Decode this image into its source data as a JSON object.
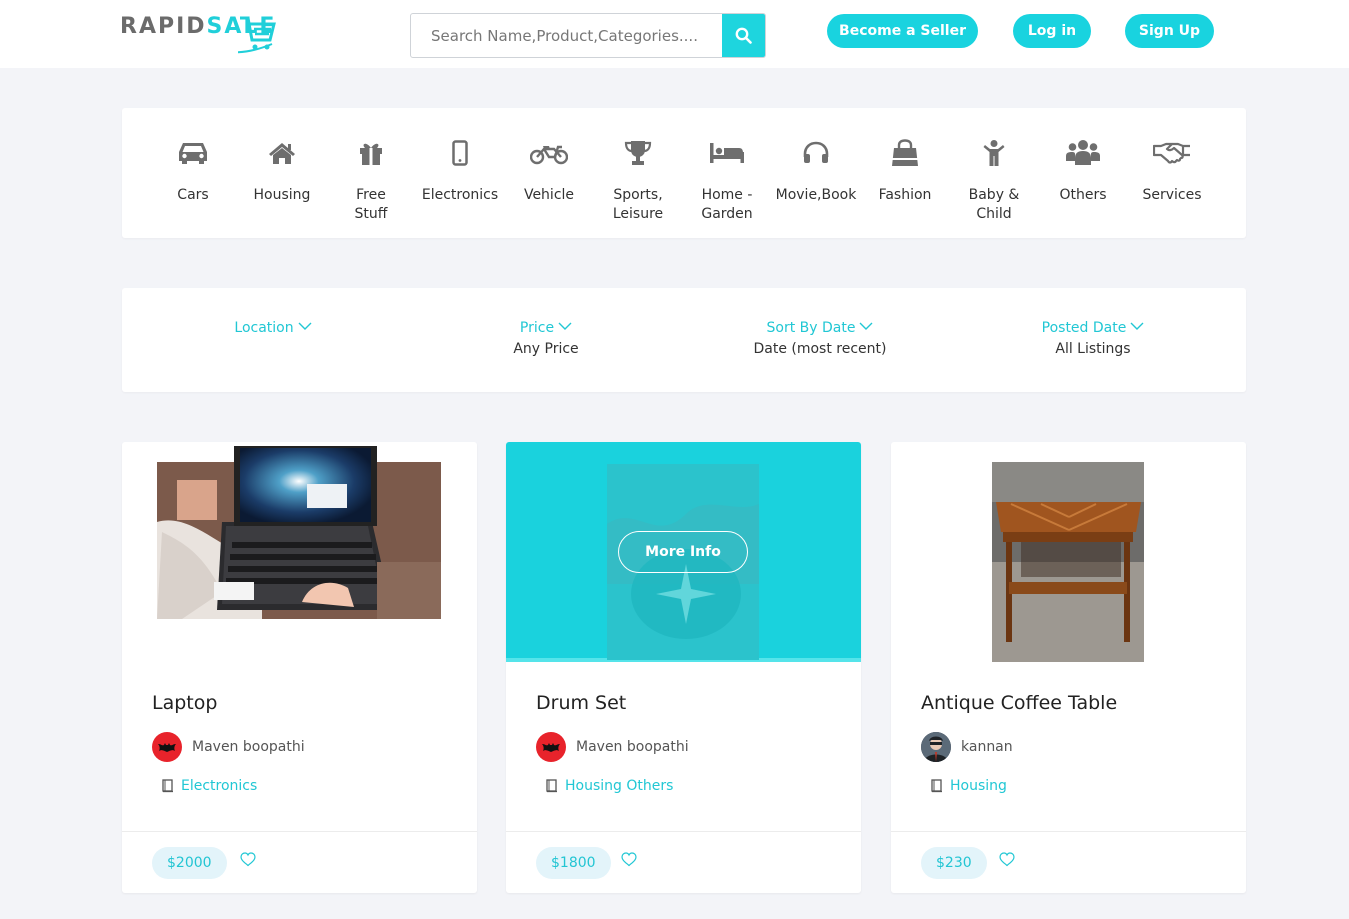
{
  "brand": {
    "part1": "RAPID",
    "part2": "SALE"
  },
  "search": {
    "placeholder": "Search Name,Product,Categories...."
  },
  "header_buttons": {
    "seller": "Become a Seller",
    "login": "Log in",
    "signup": "Sign Up"
  },
  "categories": [
    {
      "label": "Cars",
      "icon": "car-icon"
    },
    {
      "label": "Housing",
      "icon": "home-icon"
    },
    {
      "label": "Free Stuff",
      "icon": "gift-icon"
    },
    {
      "label": "Electronics",
      "icon": "mobile-icon"
    },
    {
      "label": "Vehicle",
      "icon": "motorcycle-icon"
    },
    {
      "label": "Sports, Leisure",
      "icon": "trophy-icon"
    },
    {
      "label": "Home - Garden",
      "icon": "bed-icon"
    },
    {
      "label": "Movie,Book",
      "icon": "headphones-icon"
    },
    {
      "label": "Fashion",
      "icon": "shopping-bag-icon"
    },
    {
      "label": "Baby & Child",
      "icon": "child-icon"
    },
    {
      "label": "Others",
      "icon": "users-icon"
    },
    {
      "label": "Services",
      "icon": "handshake-icon"
    }
  ],
  "filters": [
    {
      "title": "Location",
      "value": ""
    },
    {
      "title": "Price",
      "value": "Any Price"
    },
    {
      "title": "Sort By Date",
      "value": "Date (most recent)"
    },
    {
      "title": "Posted Date",
      "value": "All Listings"
    }
  ],
  "listings": [
    {
      "title": "Laptop",
      "seller": "Maven boopathi",
      "category": "Electronics",
      "price": "$2000"
    },
    {
      "title": "Drum Set",
      "seller": "Maven boopathi",
      "category": "Housing Others",
      "price": "$1800",
      "overlay_button": "More Info"
    },
    {
      "title": "Antique Coffee Table",
      "seller": "kannan",
      "category": "Housing",
      "price": "$230"
    }
  ],
  "colors": {
    "accent": "#19d3df",
    "text": "#333333",
    "background": "#f3f4f8"
  }
}
